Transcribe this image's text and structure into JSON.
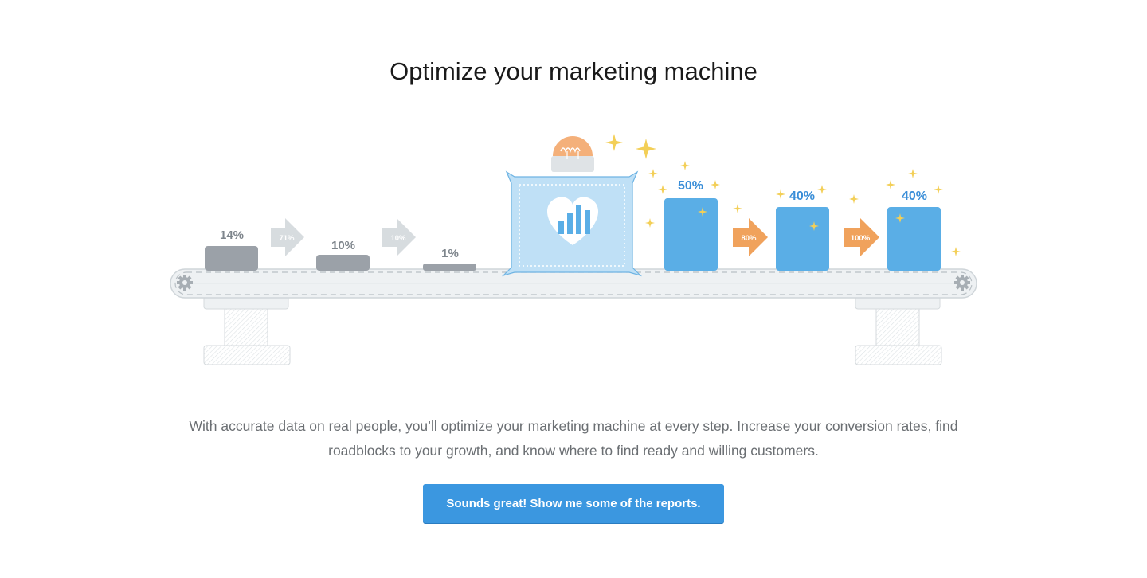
{
  "page": {
    "title": "Optimize your marketing machine",
    "description": "With accurate data on real people, you’ll optimize your marketing machine at every step. Increase your conversion rates, find roadblocks to your growth, and know where to find ready and willing customers.",
    "cta_label": "Sounds great! Show me some of the reports."
  },
  "illustration": {
    "before": {
      "blocks": [
        {
          "label": "14%",
          "value": 14
        },
        {
          "label": "10%",
          "value": 10
        },
        {
          "label": "1%",
          "value": 1
        }
      ],
      "arrows": [
        "71%",
        "10%"
      ]
    },
    "after": {
      "blocks": [
        {
          "label": "50%",
          "value": 50
        },
        {
          "label": "40%",
          "value": 40
        },
        {
          "label": "40%",
          "value": 40
        }
      ],
      "arrows": [
        "80%",
        "100%"
      ]
    },
    "colors": {
      "gray_block": "#9ba1a8",
      "blue_block": "#5aaee6",
      "blue_text": "#3a8ed8",
      "orange_arrow": "#f0a25c",
      "gray_arrow": "#d7dcdf",
      "sparkle": "#f3cf57",
      "machine_fill": "#bfe0f6",
      "bulb": "#f4b07a"
    },
    "icons": [
      "heart-chart-icon",
      "lightbulb-icon",
      "gear-icon",
      "sparkle-icon"
    ]
  }
}
